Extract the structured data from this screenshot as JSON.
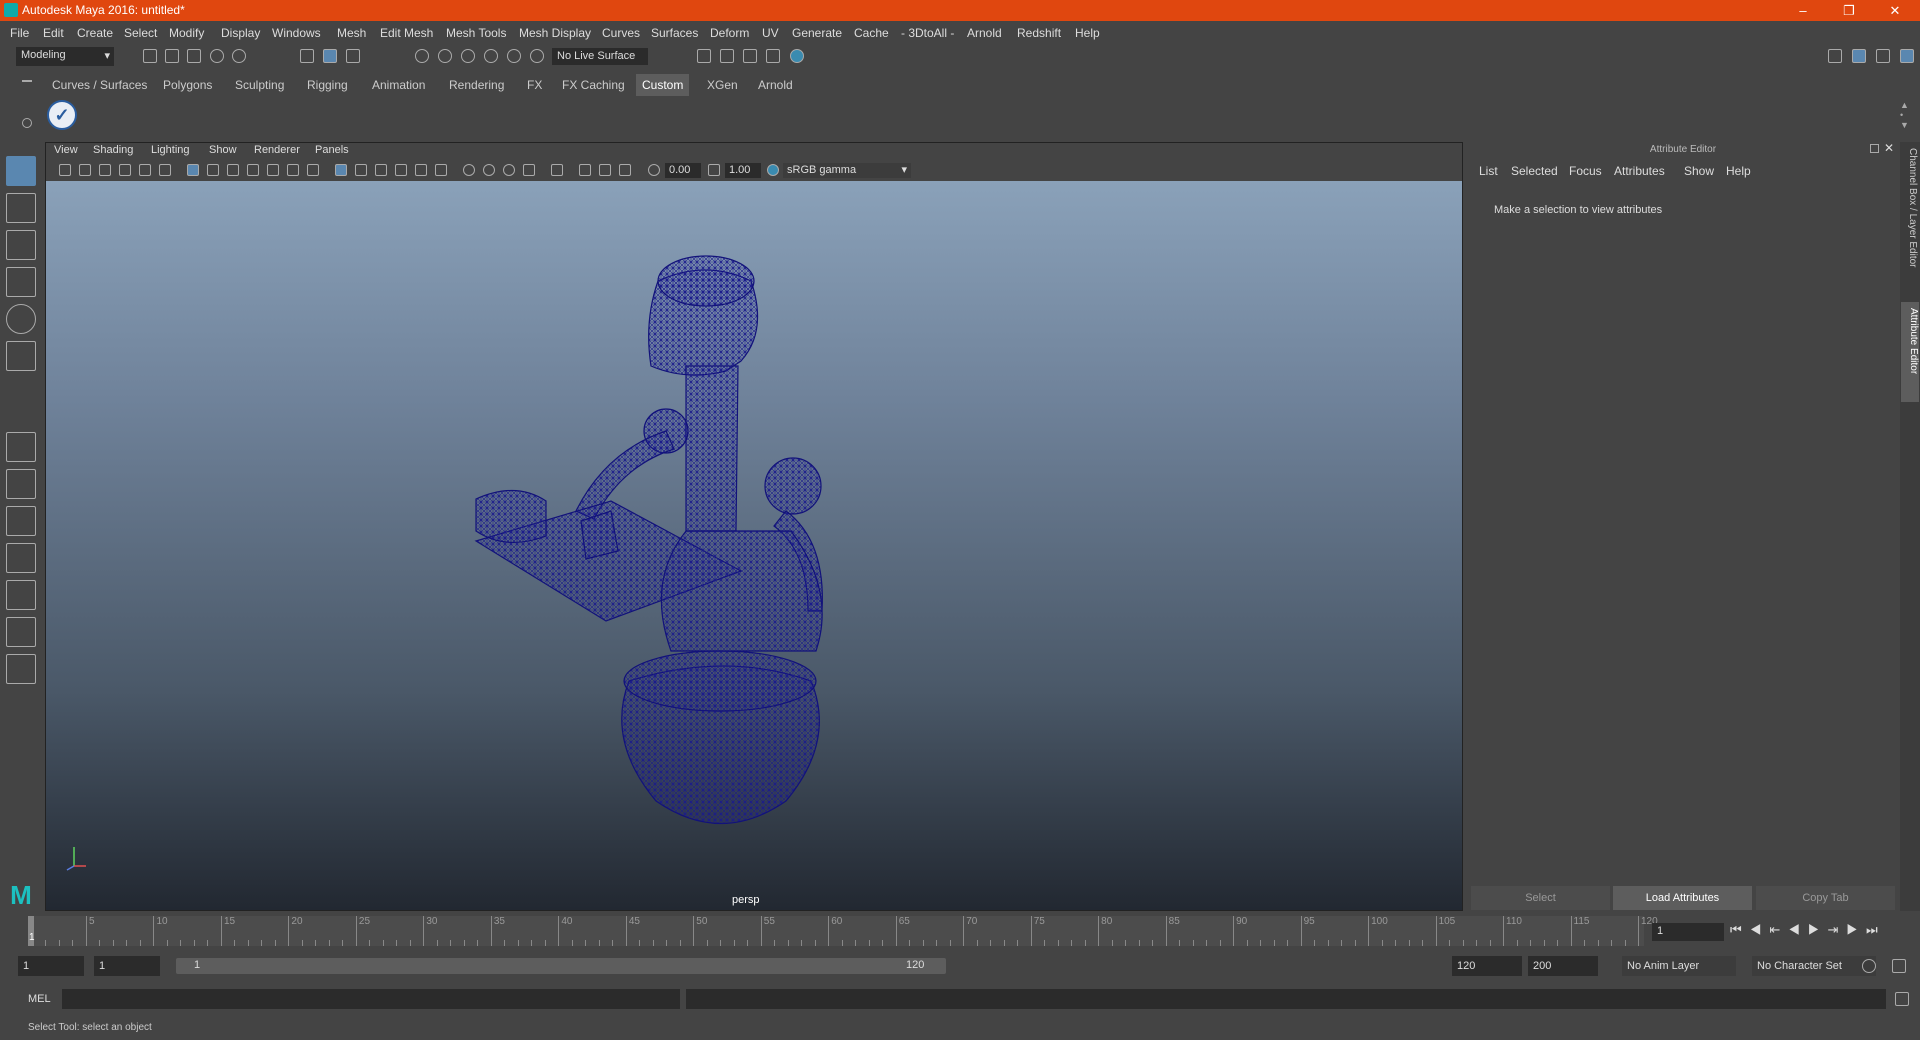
{
  "window": {
    "title": "Autodesk Maya 2016: untitled*"
  },
  "menubar": [
    "File",
    "Edit",
    "Create",
    "Select",
    "Modify",
    "Display",
    "Windows",
    "Mesh",
    "Edit Mesh",
    "Mesh Tools",
    "Mesh Display",
    "Curves",
    "Surfaces",
    "Deform",
    "UV",
    "Generate",
    "Cache",
    "- 3DtoAll -",
    "Arnold",
    "Redshift",
    "Help"
  ],
  "status_line": {
    "menuset": "Modeling",
    "live_surface": "No Live Surface"
  },
  "shelf_tabs": [
    "Curves / Surfaces",
    "Polygons",
    "Sculpting",
    "Rigging",
    "Animation",
    "Rendering",
    "FX",
    "FX Caching",
    "Custom",
    "XGen",
    "Arnold"
  ],
  "shelf_active": "Custom",
  "viewport": {
    "menus": [
      "View",
      "Shading",
      "Lighting",
      "Show",
      "Renderer",
      "Panels"
    ],
    "exposure": "0.00",
    "gamma": "1.00",
    "color_space": "sRGB gamma",
    "camera_label": "persp"
  },
  "attribute_editor": {
    "title": "Attribute Editor",
    "menus": [
      "List",
      "Selected",
      "Focus",
      "Attributes",
      "Show",
      "Help"
    ],
    "message": "Make a selection to view attributes",
    "buttons": {
      "select": "Select",
      "load": "Load Attributes",
      "copy": "Copy Tab"
    }
  },
  "side_tabs": {
    "channel_box": "Channel Box / Layer Editor",
    "attr_editor": "Attribute Editor"
  },
  "timeline": {
    "ticks": [
      "5",
      "10",
      "15",
      "20",
      "25",
      "30",
      "35",
      "40",
      "45",
      "50",
      "55",
      "60",
      "65",
      "70",
      "75",
      "80",
      "85",
      "90",
      "95",
      "100",
      "105",
      "110",
      "115",
      "120"
    ],
    "start_marker": "1",
    "current_frame": "1"
  },
  "range": {
    "start": "1",
    "playback_start": "1",
    "slider_start": "1",
    "slider_end": "120",
    "playback_end": "120",
    "end": "200",
    "anim_layer": "No Anim Layer",
    "character_set": "No Character Set"
  },
  "command_line": {
    "label": "MEL"
  },
  "help_line": {
    "text": "Select Tool: select an object"
  }
}
